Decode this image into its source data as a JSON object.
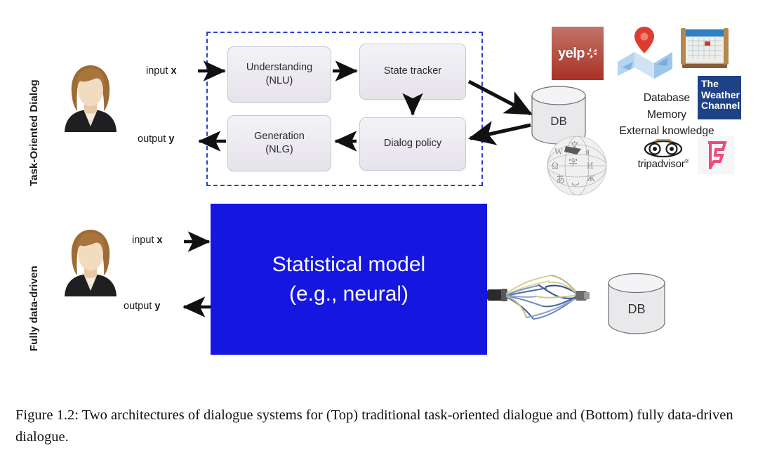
{
  "figure": {
    "rows": [
      {
        "label": "Task-Oriented Dialog"
      },
      {
        "label": "Fully data-driven"
      }
    ],
    "io": {
      "input_prefix": "input ",
      "input_symbol": "x",
      "output_prefix": "output ",
      "output_symbol": "y"
    },
    "top_pipeline": {
      "boxes": [
        {
          "line1": "Understanding",
          "line2": "(NLU)"
        },
        {
          "line1": "State tracker",
          "line2": ""
        },
        {
          "line1": "Generation",
          "line2": "(NLG)"
        },
        {
          "line1": "Dialog policy",
          "line2": ""
        }
      ],
      "db_label": "DB",
      "knowledge_lines": [
        "Database",
        "Memory",
        "External knowledge"
      ],
      "logos": [
        {
          "name": "yelp",
          "text": "yelp"
        },
        {
          "name": "maps",
          "text": ""
        },
        {
          "name": "calendar",
          "text": ""
        },
        {
          "name": "weather-channel",
          "line1": "The",
          "line2": "Weather",
          "line3": "Channel"
        },
        {
          "name": "wikipedia",
          "text": ""
        },
        {
          "name": "tripadvisor",
          "text": "tripadvisor",
          "registered": "®"
        },
        {
          "name": "foursquare",
          "text": ""
        }
      ]
    },
    "bottom_pipeline": {
      "model_line1": "Statistical model",
      "model_line2": "(e.g., neural)",
      "db_label": "DB"
    },
    "caption": "Figure 1.2: Two architectures of dialogue systems for (Top) traditional task-oriented dialogue and (Bottom) fully data-driven dialogue."
  },
  "colors": {
    "dashed_border": "#2b3fd4",
    "model_blue": "#1516e0",
    "yelp_red": "#a93226",
    "weather_blue": "#1f4287",
    "foursquare_pink": "#ef4b78",
    "box_fill": "#ecebf0"
  }
}
